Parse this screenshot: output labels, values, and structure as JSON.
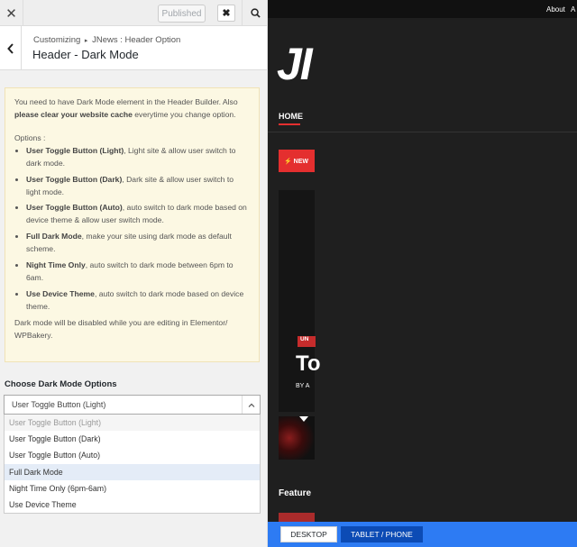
{
  "topbar": {
    "close_icon": "close-icon",
    "published_label": "Published",
    "x_label": "✖",
    "search_icon": "search-icon"
  },
  "titlebar": {
    "back_icon": "chevron-left-icon",
    "breadcrumb_parent": "Customizing",
    "breadcrumb_child": "JNews : Header Option",
    "title": "Header - Dark Mode"
  },
  "notice": {
    "line1": "You need to have Dark Mode element in the Header Builder. Also",
    "line2_bold": "please clear your website cache",
    "line2_rest": " everytime you change option.",
    "options_heading": "Options :",
    "items": [
      {
        "bold": "User Toggle Button (Light)",
        "text": ", Light site & allow user switch to dark mode."
      },
      {
        "bold": "User Toggle Button (Dark)",
        "text": ", Dark site & allow user switch to light mode."
      },
      {
        "bold": "User Toggle Button (Auto)",
        "text": ", auto switch to dark mode based on device theme & allow user switch mode."
      },
      {
        "bold": "Full Dark Mode",
        "text": ", make your site using dark mode as default scheme."
      },
      {
        "bold": "Night Time Only",
        "text": ", auto switch to dark mode between 6pm to 6am."
      },
      {
        "bold": "Use Device Theme",
        "text": ", auto switch to dark mode based on device theme."
      }
    ],
    "footer": "Dark mode will be disabled while you are editing in Elementor/ WPBakery."
  },
  "control": {
    "label": "Choose Dark Mode Options",
    "selected": "User Toggle Button (Light)",
    "options": [
      "User Toggle Button (Light)",
      "User Toggle Button (Dark)",
      "User Toggle Button (Auto)",
      "Full Dark Mode",
      "Night Time Only (6pm-6am)",
      "Use Device Theme"
    ]
  },
  "preview": {
    "topnav": [
      "About",
      "A"
    ],
    "logo": "JI",
    "nav_home": "HOME",
    "news_tag": "⚡ NEW",
    "hero_category": "UN",
    "hero_title": "To",
    "hero_byline": "BY A",
    "feature_heading": "Feature"
  },
  "devicebar": {
    "desktop_label": "DESKTOP",
    "tablet_label": "TABLET / PHONE"
  },
  "colors": {
    "accent": "#2d7bf3",
    "brand_red": "#e42f2f",
    "notice_bg": "#fcf8e3",
    "active_option_bg": "#e4ecf7"
  }
}
